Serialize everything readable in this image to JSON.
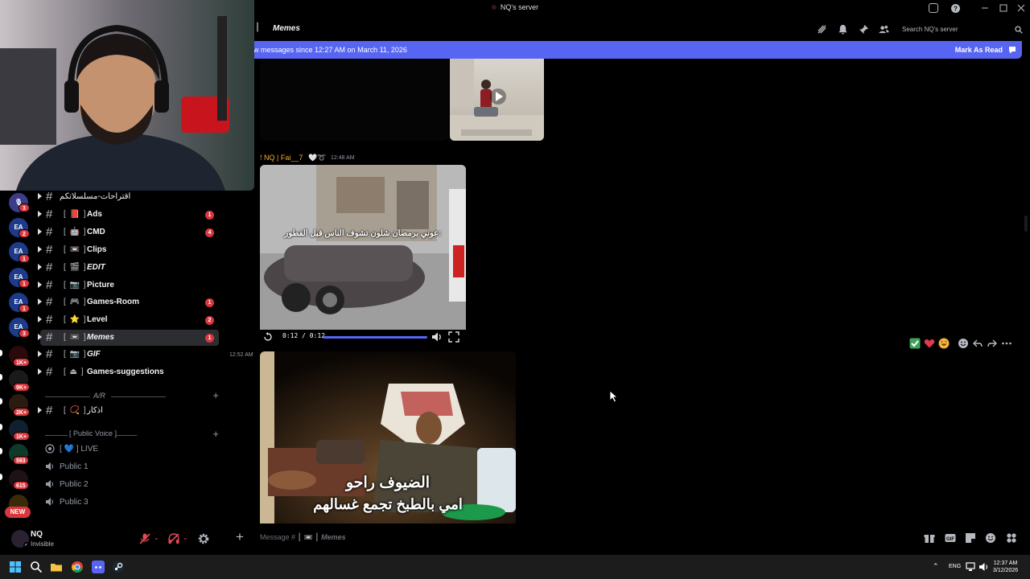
{
  "window": {
    "title": "NQ's server"
  },
  "header": {
    "channel_deco": "┃",
    "channel_name": "Memes",
    "search_placeholder": "Search NQ's server"
  },
  "new_messages_bar": {
    "text": "w messages since 12:27 AM on March 11, 2026",
    "mark_as_read": "Mark As Read"
  },
  "servers": [
    {
      "badge": "3"
    },
    {
      "label": "EA",
      "badge": "2"
    },
    {
      "label": "EA",
      "badge": "1"
    },
    {
      "label": "EA",
      "badge": "1"
    },
    {
      "label": "EA",
      "badge": "1"
    },
    {
      "label": "EA",
      "badge": "3"
    },
    {
      "badge": "1K+"
    },
    {
      "badge": "9K+"
    },
    {
      "badge": "2K+"
    },
    {
      "badge": "1K+"
    },
    {
      "badge": "593"
    },
    {
      "badge": "615"
    },
    {
      "badge": "NEW"
    }
  ],
  "channels": [
    {
      "name": "اقتراحات-مسلسلاتكم",
      "deco": "",
      "badge": ""
    },
    {
      "name": "Ads",
      "deco": "[ 📕 ]",
      "badge": "1"
    },
    {
      "name": "CMD",
      "deco": "[ 🤖 ]",
      "badge": "4"
    },
    {
      "name": "Clips",
      "deco": "[ 📼 ]",
      "badge": ""
    },
    {
      "name": "EDIT",
      "deco": "[ 🎬 ]",
      "badge": ""
    },
    {
      "name": "Picture",
      "deco": "[ 📷 ]",
      "badge": ""
    },
    {
      "name": "Games-Room",
      "deco": "[ 🎮 ]",
      "badge": "1"
    },
    {
      "name": "Level",
      "deco": "[ ⭐ ]",
      "badge": "2"
    },
    {
      "name": "Memes",
      "deco": "[ 📼 ]",
      "badge": "1"
    },
    {
      "name": "GIF",
      "deco": "[ 📷 ]",
      "badge": ""
    },
    {
      "name": "Games-suggestions",
      "deco": "[ ⏏ ]",
      "badge": ""
    },
    {
      "name": "اذكار",
      "deco": "[ 📿 ]",
      "badge": ""
    }
  ],
  "categories": {
    "azkar": "A/R",
    "public_voice": "[ Public Voice ]"
  },
  "voice_channels": [
    {
      "name": "LIVE",
      "deco": "[ 💙 ]"
    },
    {
      "name": "Public 1"
    },
    {
      "name": "Public 2"
    },
    {
      "name": "Public 3"
    }
  ],
  "user": {
    "name": "NQ",
    "status": "Invisible"
  },
  "message": {
    "author": "! NQ | Fai__7",
    "emoji": "🤍➰",
    "time": "12:48 AM",
    "next_time": "12:52 AM",
    "video_time": "0:12 / 0:12",
    "video_progress": 1.0,
    "video1_caption": "عوني برمضان شلون تشوف الناس قبل الفطور:",
    "video2_caption_line1": "الضيوف راحو",
    "video2_caption_line2": "امي بالطبخ تجمع غسالهم"
  },
  "composer": {
    "placeholder_prefix": "Message #",
    "placeholder_deco": "┃ 📼 ┃",
    "placeholder_channel": "Memes"
  },
  "taskbar": {
    "lang": "ENG",
    "time": "12:37 AM",
    "date": "3/12/2026"
  },
  "colors": {
    "blurple": "#5865f2",
    "mention_red": "#da373c",
    "author_gold": "#f0b232"
  }
}
